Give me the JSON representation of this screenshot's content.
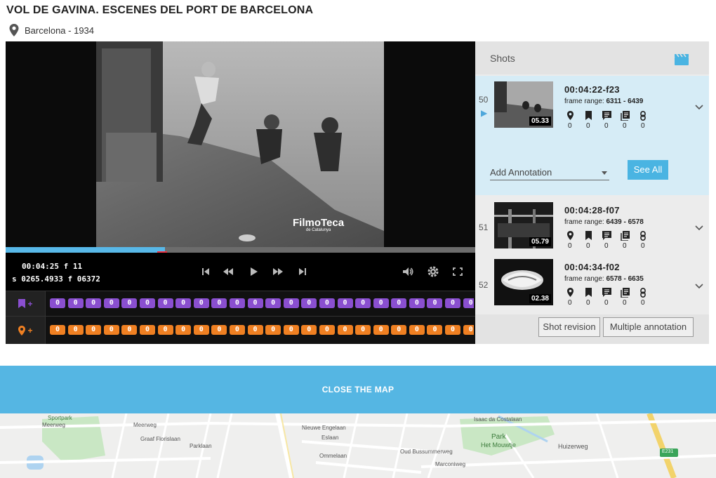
{
  "header": {
    "title": "VOL DE GAVINA. ESCENES DEL PORT DE BARCELONA",
    "location": "Barcelona - 1934"
  },
  "player": {
    "watermark": "FilmoTeca",
    "watermark_sub": "de Catalunya",
    "progress_fraction": 0.34,
    "timecode": {
      "line1": "00:04:25  f 11",
      "line2": "s 0265.4933 f 06372"
    },
    "tracks": {
      "bookmark_add": "+",
      "location_add": "+",
      "bookmark_counts": [
        "0",
        "0",
        "0",
        "0",
        "0",
        "0",
        "0",
        "0",
        "0",
        "0",
        "0",
        "0",
        "0",
        "0",
        "0",
        "0",
        "0",
        "0",
        "0",
        "0",
        "0",
        "0",
        "0",
        "0"
      ],
      "location_counts": [
        "0",
        "0",
        "0",
        "0",
        "0",
        "0",
        "0",
        "0",
        "0",
        "0",
        "0",
        "0",
        "0",
        "0",
        "0",
        "0",
        "0",
        "0",
        "0",
        "0",
        "0",
        "0",
        "0",
        "0"
      ]
    }
  },
  "shots": {
    "header": "Shots",
    "items": [
      {
        "number": "50",
        "duration": "05.33",
        "timecode": "00:04:22-f23",
        "frame_label": "frame range:",
        "frame_range": "6311 - 6439",
        "counts": [
          "0",
          "0",
          "0",
          "0",
          "0"
        ]
      },
      {
        "number": "51",
        "duration": "05.79",
        "timecode": "00:04:28-f07",
        "frame_label": "frame range:",
        "frame_range": "6439 - 6578",
        "counts": [
          "0",
          "0",
          "0",
          "0",
          "0"
        ]
      },
      {
        "number": "52",
        "duration": "02.38",
        "timecode": "00:04:34-f02",
        "frame_label": "frame range:",
        "frame_range": "6578 - 6635",
        "counts": [
          "0",
          "0",
          "0",
          "0",
          "0"
        ]
      }
    ],
    "add_annotation": "Add Annotation",
    "see_all": "See All",
    "shot_revision": "Shot revision",
    "multiple_annotation": "Multiple annotation"
  },
  "map": {
    "close_label": "CLOSE THE MAP",
    "labels": {
      "sportpark": "Sportpark",
      "meerweg_a": "Meerweg",
      "meerweg_b": "Meerweg",
      "grafflorisl": "Graaf Florislaan",
      "parklaan": "Parklaan",
      "nieuweenglaan": "Nieuwe Engelaan",
      "eslaan": "Eslaan",
      "ommelaan": "Ommelaan",
      "oudbussummerweg": "Oud Bussummerweg",
      "marconiweg": "Marconiweg",
      "park": "Park",
      "hetmouwtje": "Het Mouwtje",
      "huizerweg": "Huizerweg",
      "isaacdacostalaan": "Isaac da Costalaan",
      "e231": "E231"
    }
  }
}
